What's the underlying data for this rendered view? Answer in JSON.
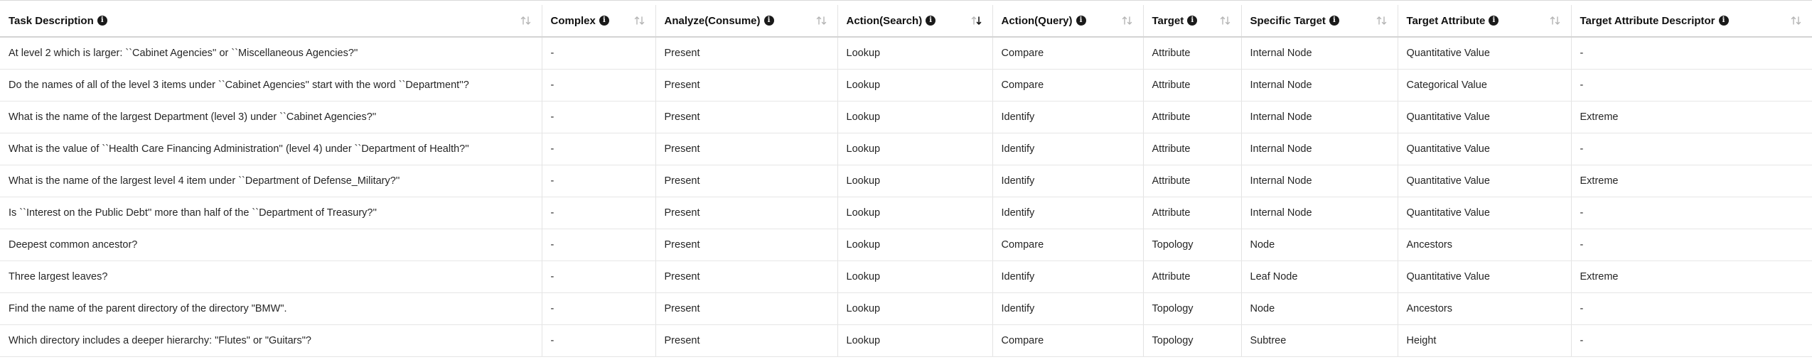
{
  "table": {
    "columns": [
      {
        "label": "Task Description",
        "sort": "none"
      },
      {
        "label": "Complex",
        "sort": "none"
      },
      {
        "label": "Analyze(Consume)",
        "sort": "none"
      },
      {
        "label": "Action(Search)",
        "sort": "descending"
      },
      {
        "label": "Action(Query)",
        "sort": "none"
      },
      {
        "label": "Target",
        "sort": "none"
      },
      {
        "label": "Specific Target",
        "sort": "none"
      },
      {
        "label": "Target Attribute",
        "sort": "none"
      },
      {
        "label": "Target Attribute Descriptor",
        "sort": "none"
      }
    ],
    "rows": [
      [
        "At level 2 which is larger: ``Cabinet Agencies'' or ``Miscellaneous Agencies?''",
        "-",
        "Present",
        "Lookup",
        "Compare",
        "Attribute",
        "Internal Node",
        "Quantitative Value",
        "-"
      ],
      [
        "Do the names of all of the level 3 items under ``Cabinet Agencies'' start with the word ``Department''?",
        "-",
        "Present",
        "Lookup",
        "Compare",
        "Attribute",
        "Internal Node",
        "Categorical Value",
        "-"
      ],
      [
        "What is the name of the largest Department (level 3) under ``Cabinet Agencies?''",
        "-",
        "Present",
        "Lookup",
        "Identify",
        "Attribute",
        "Internal Node",
        "Quantitative Value",
        "Extreme"
      ],
      [
        "What is the value of ``Health Care Financing Administration'' (level 4) under ``Department of Health?''",
        "-",
        "Present",
        "Lookup",
        "Identify",
        "Attribute",
        "Internal Node",
        "Quantitative Value",
        "-"
      ],
      [
        "What is the name of the largest level 4 item under ``Department of Defense_Military?''",
        "-",
        "Present",
        "Lookup",
        "Identify",
        "Attribute",
        "Internal Node",
        "Quantitative Value",
        "Extreme"
      ],
      [
        "Is ``Interest on the Public Debt'' more than half of the ``Department of Treasury?''",
        "-",
        "Present",
        "Lookup",
        "Identify",
        "Attribute",
        "Internal Node",
        "Quantitative Value",
        "-"
      ],
      [
        "Deepest common ancestor?",
        "-",
        "Present",
        "Lookup",
        "Compare",
        "Topology",
        "Node",
        "Ancestors",
        "-"
      ],
      [
        "Three largest leaves?",
        "-",
        "Present",
        "Lookup",
        "Identify",
        "Attribute",
        "Leaf Node",
        "Quantitative Value",
        "Extreme"
      ],
      [
        "Find the name of the parent directory of the directory \"BMW\".",
        "-",
        "Present",
        "Lookup",
        "Identify",
        "Topology",
        "Node",
        "Ancestors",
        "-"
      ],
      [
        "Which directory includes a deeper hierarchy: \"Flutes\" or \"Guitars\"?",
        "-",
        "Present",
        "Lookup",
        "Compare",
        "Topology",
        "Subtree",
        "Height",
        "-"
      ]
    ]
  },
  "icons": {
    "info": "info-icon",
    "sort": "sort-arrows-icon",
    "sort_active": "sort-descending-icon"
  },
  "colors": {
    "header_border": "#d4d4d4",
    "row_border": "#e6e6e6",
    "sort_inactive": "#b5b5b5",
    "sort_active": "#1a1a1a"
  }
}
